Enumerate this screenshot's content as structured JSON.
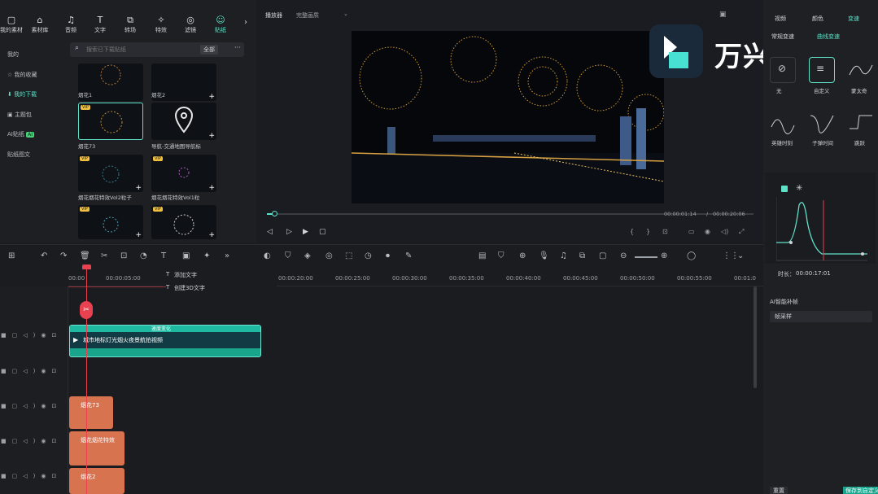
{
  "colors": {
    "accent": "#5fe0c8",
    "playhead": "#e8414f",
    "clip_teal": "#19a48c",
    "clip_orange": "#d8734f",
    "vip": "#f0c040"
  },
  "library": {
    "tabs": [
      {
        "label": "我的素材",
        "icon": "folder-icon"
      },
      {
        "label": "素材库",
        "icon": "store-icon"
      },
      {
        "label": "音频",
        "icon": "music-icon"
      },
      {
        "label": "文字",
        "icon": "text-icon"
      },
      {
        "label": "转场",
        "icon": "transition-icon"
      },
      {
        "label": "特效",
        "icon": "effects-icon"
      },
      {
        "label": "滤镜",
        "icon": "filter-icon"
      },
      {
        "label": "贴纸",
        "icon": "sticker-icon"
      }
    ],
    "sidebar": [
      "我的",
      "我的收藏",
      "我的下载",
      "主题包",
      "AI贴纸",
      "贴纸图文"
    ],
    "ai_badge": "AI",
    "search_placeholder": "搜索已下载贴纸",
    "filter": "全部",
    "items": [
      {
        "label": "烟花1",
        "vip": false
      },
      {
        "label": "烟花2",
        "vip": false
      },
      {
        "label": "烟花73",
        "vip": true
      },
      {
        "label": "导航-交通地图导航标",
        "vip": false
      },
      {
        "label": "烟花烟花特效Vol2粒子",
        "vip": true
      },
      {
        "label": "烟花烟花特效Vol1粒",
        "vip": true
      },
      {
        "label": "",
        "vip": true
      },
      {
        "label": "",
        "vip": true
      }
    ],
    "vip_text": "VIP"
  },
  "player": {
    "title": "播放器",
    "quality": "完整画质",
    "time_current": "00:00:01:14",
    "time_sep": "/",
    "time_total": "00:00:20:06"
  },
  "brand": {
    "name": "万兴喵影"
  },
  "inspector": {
    "tabs": [
      "视频",
      "颜色",
      "变速"
    ],
    "section": "常规变速",
    "active_sub": "曲线变速",
    "presets": [
      "无",
      "自定义",
      "蒙太奇",
      "英雄时刻",
      "子弹时间",
      "跳跃"
    ],
    "time_label": "时长：",
    "time_value": "00:00:17:01",
    "ai_label": "AI智能补帧",
    "ai_value": "帧采样",
    "reset": "重置",
    "ok": "保存到自定义"
  },
  "timeline": {
    "ticks": [
      "00:00",
      "00:00:05:00",
      "00:00:20:00",
      "00:00:25:00",
      "00:00:30:00",
      "00:00:35:00",
      "00:00:40:00",
      "00:00:45:00",
      "00:00:50:00",
      "00:00:55:00",
      "00:01:0"
    ],
    "menu": [
      "添加文字",
      "创建3D文字"
    ],
    "teal_header": "速度变化",
    "teal_title": "城市地标灯光烟火夜景航拍视频",
    "orange_clips": [
      "烟花73",
      "烟花烟花特效",
      "烟花2"
    ]
  }
}
